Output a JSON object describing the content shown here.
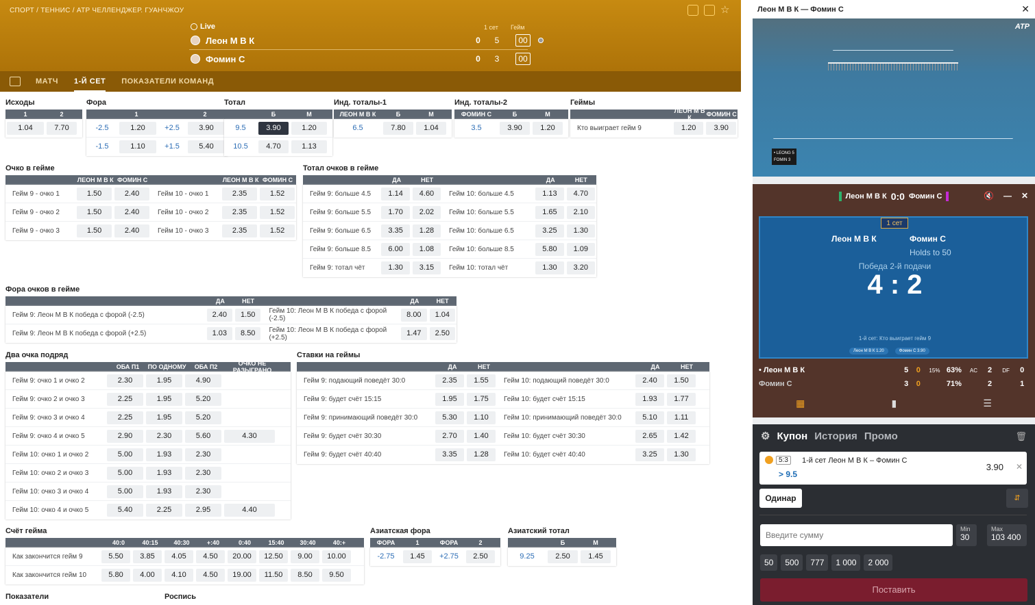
{
  "header": {
    "breadcrumb": "СПОРТ / ТЕННИС / ATP ЧЕЛЛЕНДЖЕР. ГУАНЧЖОУ",
    "live": "Live",
    "col_set": "1 сет",
    "col_game": "Гейм",
    "p1": {
      "name": "Леон М В К",
      "sets": "0",
      "set1": "5",
      "game": "00"
    },
    "p2": {
      "name": "Фомин С",
      "sets": "0",
      "set1": "3",
      "game": "00"
    }
  },
  "tabs": [
    "МАТЧ",
    "1-Й СЕТ",
    "ПОКАЗАТЕЛИ КОМАНД"
  ],
  "ishody": {
    "title": "Исходы",
    "h": [
      "1",
      "2"
    ],
    "r": [
      [
        "1.04",
        "7.70"
      ]
    ]
  },
  "fora": {
    "title": "Фора",
    "h": [
      "1",
      "2"
    ],
    "r": [
      [
        "-2.5",
        "1.20",
        "+2.5",
        "3.90"
      ],
      [
        "-1.5",
        "1.10",
        "+1.5",
        "5.40"
      ]
    ]
  },
  "total": {
    "title": "Тотал",
    "h": [
      "Б",
      "М"
    ],
    "r": [
      [
        "9.5",
        "3.90",
        "1.20"
      ],
      [
        "10.5",
        "4.70",
        "1.13"
      ]
    ]
  },
  "ind1": {
    "title": "Инд. тоталы-1",
    "h": [
      "ЛЕОН М В К",
      "Б",
      "М"
    ],
    "r": [
      [
        "6.5",
        "7.80",
        "1.04"
      ]
    ]
  },
  "ind2": {
    "title": "Инд. тоталы-2",
    "h": [
      "ФОМИН С",
      "Б",
      "М"
    ],
    "r": [
      [
        "3.5",
        "3.90",
        "1.20"
      ]
    ]
  },
  "geimy": {
    "title": "Геймы",
    "h": [
      "ЛЕОН М В К",
      "ФОМИН С"
    ],
    "r": [
      [
        "Кто выиграет гейм 9",
        "1.20",
        "3.90"
      ]
    ]
  },
  "ochko": {
    "title": "Очко в гейме",
    "h": [
      "ЛЕОН М В К",
      "ФОМИН С",
      "ЛЕОН М В К",
      "ФОМИН С"
    ],
    "r": [
      [
        "Гейм 9 - очко 1",
        "1.50",
        "2.40",
        "Гейм 10 - очко 1",
        "2.35",
        "1.52"
      ],
      [
        "Гейм 9 - очко 2",
        "1.50",
        "2.40",
        "Гейм 10 - очко 2",
        "2.35",
        "1.52"
      ],
      [
        "Гейм 9 - очко 3",
        "1.50",
        "2.40",
        "Гейм 10 - очко 3",
        "2.35",
        "1.52"
      ]
    ]
  },
  "totoch": {
    "title": "Тотал очков в гейме",
    "h": [
      "ДА",
      "НЕТ",
      "ДА",
      "НЕТ"
    ],
    "r": [
      [
        "Гейм 9: больше 4.5",
        "1.14",
        "4.60",
        "Гейм 10: больше 4.5",
        "1.13",
        "4.70"
      ],
      [
        "Гейм 9: больше 5.5",
        "1.70",
        "2.02",
        "Гейм 10: больше 5.5",
        "1.65",
        "2.10"
      ],
      [
        "Гейм 9: больше 6.5",
        "3.35",
        "1.28",
        "Гейм 10: больше 6.5",
        "3.25",
        "1.30"
      ],
      [
        "Гейм 9: больше 8.5",
        "6.00",
        "1.08",
        "Гейм 10: больше 8.5",
        "5.80",
        "1.09"
      ],
      [
        "Гейм 9: тотал чёт",
        "1.30",
        "3.15",
        "Гейм 10: тотал чёт",
        "1.30",
        "3.20"
      ]
    ]
  },
  "foroch": {
    "title": "Фора очков в гейме",
    "h": [
      "ДА",
      "НЕТ",
      "ДА",
      "НЕТ"
    ],
    "r": [
      [
        "Гейм 9: Леон М В К победа с форой (-2.5)",
        "2.40",
        "1.50",
        "Гейм 10: Леон М В К победа с форой (-2.5)",
        "8.00",
        "1.04"
      ],
      [
        "Гейм 9: Леон М В К победа с форой (+2.5)",
        "1.03",
        "8.50",
        "Гейм 10: Леон М В К победа с форой (+2.5)",
        "1.47",
        "2.50"
      ]
    ]
  },
  "dva": {
    "title": "Два очка подряд",
    "h": [
      "ОБА П1",
      "ПО ОДНОМУ",
      "ОБА П2",
      "ОЧКО НЕ РАЗЫГРАНО"
    ],
    "r": [
      [
        "Гейм 9: очко 1 и очко 2",
        "2.30",
        "1.95",
        "4.90",
        ""
      ],
      [
        "Гейм 9: очко 2 и очко 3",
        "2.25",
        "1.95",
        "5.20",
        ""
      ],
      [
        "Гейм 9: очко 3 и очко 4",
        "2.25",
        "1.95",
        "5.20",
        ""
      ],
      [
        "Гейм 9: очко 4 и очко 5",
        "2.90",
        "2.30",
        "5.60",
        "4.30"
      ],
      [
        "Гейм 10: очко 1 и очко 2",
        "5.00",
        "1.93",
        "2.30",
        ""
      ],
      [
        "Гейм 10: очко 2 и очко 3",
        "5.00",
        "1.93",
        "2.30",
        ""
      ],
      [
        "Гейм 10: очко 3 и очко 4",
        "5.00",
        "1.93",
        "2.30",
        ""
      ],
      [
        "Гейм 10: очко 4 и очко 5",
        "5.40",
        "2.25",
        "2.95",
        "4.40"
      ]
    ]
  },
  "stavki": {
    "title": "Ставки на геймы",
    "h": [
      "ДА",
      "НЕТ",
      "ДА",
      "НЕТ"
    ],
    "r": [
      [
        "Гейм 9: подающий поведёт 30:0",
        "2.35",
        "1.55",
        "Гейм 10: подающий поведёт 30:0",
        "2.40",
        "1.50"
      ],
      [
        "Гейм 9: будет счёт 15:15",
        "1.95",
        "1.75",
        "Гейм 10: будет счёт 15:15",
        "1.93",
        "1.77"
      ],
      [
        "Гейм 9: принимающий поведёт 30:0",
        "5.30",
        "1.10",
        "Гейм 10: принимающий поведёт 30:0",
        "5.10",
        "1.11"
      ],
      [
        "Гейм 9: будет счёт 30:30",
        "2.70",
        "1.40",
        "Гейм 10: будет счёт 30:30",
        "2.65",
        "1.42"
      ],
      [
        "Гейм 9: будет счёт 40:40",
        "3.35",
        "1.28",
        "Гейм 10: будет счёт 40:40",
        "3.25",
        "1.30"
      ]
    ]
  },
  "schet": {
    "title": "Счёт гейма",
    "h": [
      "40:0",
      "40:15",
      "40:30",
      "+:40",
      "0:40",
      "15:40",
      "30:40",
      "40:+"
    ],
    "r": [
      [
        "Как закончится гейм 9",
        "5.50",
        "3.85",
        "4.05",
        "4.50",
        "20.00",
        "12.50",
        "9.00",
        "10.00"
      ],
      [
        "Как закончится гейм 10",
        "5.80",
        "4.00",
        "4.10",
        "4.50",
        "19.00",
        "11.50",
        "8.50",
        "9.50"
      ]
    ]
  },
  "aziafora": {
    "title": "Азиатская фора",
    "h": [
      "ФОРА",
      "1",
      "ФОРА",
      "2"
    ],
    "r": [
      [
        "-2.75",
        "1.45",
        "+2.75",
        "2.50"
      ]
    ]
  },
  "aziatot": {
    "title": "Азиатский тотал",
    "h": [
      "Б",
      "М"
    ],
    "r": [
      [
        "9.25",
        "2.50",
        "1.45"
      ]
    ]
  },
  "bottom": {
    "a": "Показатели",
    "b": "Роспись"
  },
  "video": {
    "title": "Леон М В К — Фомин С",
    "atp": "ATP",
    "bug1": "• LEONG  5",
    "bug2": "FOMIN  3"
  },
  "tracker": {
    "p1": "Леон М В К",
    "p2": "Фомин С",
    "score": "0:0",
    "set": "1 сет",
    "holds": "Holds to 50",
    "win": "Победа 2-й подачи",
    "big": "4 : 2",
    "market": "1-й сет: Кто выиграет гейм 9",
    "m1": "Леон М В К  1.20",
    "m2": "Фомин С  3.90",
    "s1": {
      "n": "• Леон М В К",
      "a": "5",
      "b": "0",
      "p": "63%",
      "c": "2",
      "d": "0"
    },
    "s2": {
      "n": "Фомин С",
      "a": "3",
      "b": "0",
      "p": "71%",
      "c": "2",
      "d": "1"
    },
    "lbl15": "15%",
    "ac": "AC",
    "df": "DF"
  },
  "coupon": {
    "tabs": [
      "Купон",
      "История",
      "Промо"
    ],
    "score": "5:3",
    "event": "1-й сет Леон М В К – Фомин С",
    "sel": "> 9.5",
    "odd": "3.90",
    "type": "Одинар",
    "placeholder": "Введите сумму",
    "min_l": "Min",
    "min": "30",
    "max_l": "Max",
    "max": "103 400",
    "quick": [
      "50",
      "500",
      "777",
      "1 000",
      "2 000"
    ],
    "place": "Поставить"
  },
  "colors": {
    "header": "#b57a0b",
    "tracker": "#53342a",
    "coupon": "#2b2e33",
    "place": "#7a1d2e"
  }
}
